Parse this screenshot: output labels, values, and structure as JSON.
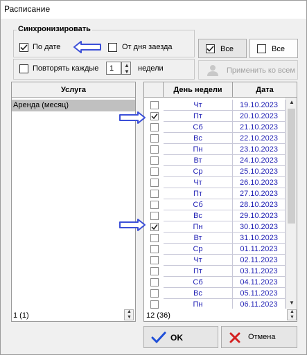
{
  "window": {
    "title": "Расписание"
  },
  "sync": {
    "group_title": "Синхронизировать",
    "by_date_label": "По дате",
    "from_day_label": "От дня заезда",
    "repeat_label": "Повторять каждые",
    "repeat_value": "1",
    "weeks_label": "недели"
  },
  "buttons": {
    "all_checked_label": "Все",
    "all_unchecked_label": "Все",
    "apply_all_label": "Применить ко всем",
    "ok_label": "OK",
    "cancel_label": "Отмена"
  },
  "services": {
    "header": "Услуга",
    "items": [
      "Аренда (месяц)"
    ],
    "status": "1 (1)"
  },
  "days": {
    "col_day": "День недели",
    "col_date": "Дата",
    "status": "12 (36)",
    "rows": [
      {
        "day": "Чт",
        "date": "19.10.2023",
        "checked": false
      },
      {
        "day": "Пт",
        "date": "20.10.2023",
        "checked": true
      },
      {
        "day": "Сб",
        "date": "21.10.2023",
        "checked": false
      },
      {
        "day": "Вс",
        "date": "22.10.2023",
        "checked": false
      },
      {
        "day": "Пн",
        "date": "23.10.2023",
        "checked": false
      },
      {
        "day": "Вт",
        "date": "24.10.2023",
        "checked": false
      },
      {
        "day": "Ср",
        "date": "25.10.2023",
        "checked": false
      },
      {
        "day": "Чт",
        "date": "26.10.2023",
        "checked": false
      },
      {
        "day": "Пт",
        "date": "27.10.2023",
        "checked": false
      },
      {
        "day": "Сб",
        "date": "28.10.2023",
        "checked": false
      },
      {
        "day": "Вс",
        "date": "29.10.2023",
        "checked": false
      },
      {
        "day": "Пн",
        "date": "30.10.2023",
        "checked": true
      },
      {
        "day": "Вт",
        "date": "31.10.2023",
        "checked": false
      },
      {
        "day": "Ср",
        "date": "01.11.2023",
        "checked": false
      },
      {
        "day": "Чт",
        "date": "02.11.2023",
        "checked": false
      },
      {
        "day": "Пт",
        "date": "03.11.2023",
        "checked": false
      },
      {
        "day": "Сб",
        "date": "04.11.2023",
        "checked": false
      },
      {
        "day": "Вс",
        "date": "05.11.2023",
        "checked": false
      },
      {
        "day": "Пн",
        "date": "06.11.2023",
        "checked": false
      }
    ]
  },
  "colors": {
    "accent_text": "#1f1fb4",
    "annotation_arrow": "#3b4fd8",
    "cancel_x": "#d42020",
    "ok_check": "#1f4fd8"
  }
}
